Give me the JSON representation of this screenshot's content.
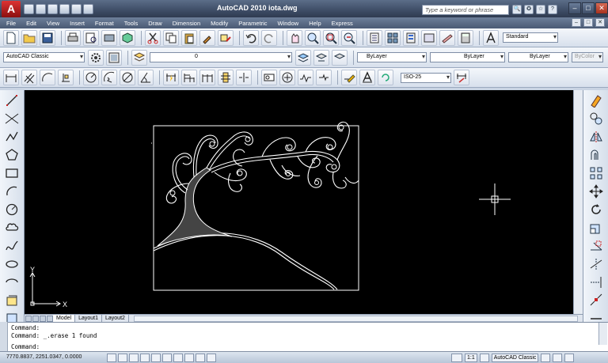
{
  "app": {
    "logo_letter": "A",
    "title": "AutoCAD 2010    iota.dwg",
    "help_search_placeholder": "Type a keyword or phrase"
  },
  "window_controls": {
    "minimize": "–",
    "maximize": "□",
    "close": "✕"
  },
  "help_icons": [
    "🔍",
    "✪",
    "☆",
    "?"
  ],
  "menu": [
    "File",
    "Edit",
    "View",
    "Insert",
    "Format",
    "Tools",
    "Draw",
    "Dimension",
    "Modify",
    "Parametric",
    "Window",
    "Help",
    "Express"
  ],
  "doc_controls": [
    "–",
    "□",
    "✕"
  ],
  "toolbar3": {
    "text_style": "Standard",
    "dim_style": "ISO-25"
  },
  "properties": {
    "workspace": "AutoCAD Classic",
    "layer": "0",
    "color": "ByLayer",
    "linetype": "ByLayer",
    "lineweight": "ByLayer",
    "plotstyle": "ByColor"
  },
  "ucs": {
    "x_label": "X",
    "y_label": "Y"
  },
  "layout_tabs": [
    "Model",
    "Layout1",
    "Layout2"
  ],
  "command_lines": [
    "Command:",
    "Command:  _.erase 1 found",
    "Command:"
  ],
  "status": {
    "coordinates": "7770.8837, 2251.0347, 0.0000",
    "annotation_scale": "1:1",
    "workspace_switch": "AutoCAD Classic"
  },
  "colors": {
    "canvas": "#000000",
    "drawing_line": "#ffffff",
    "title_bar": "#3e4d66",
    "logo_red": "#c62828"
  }
}
